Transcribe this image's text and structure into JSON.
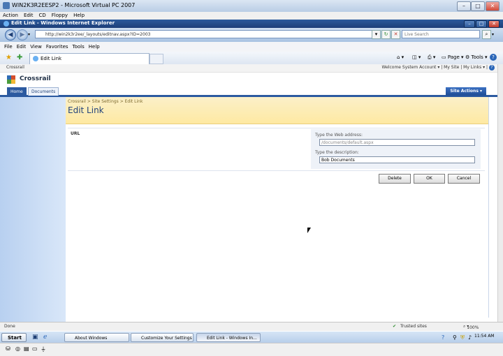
{
  "vpc": {
    "title": "WIN2K3R2EESP2 - Microsoft Virtual PC 2007",
    "menu": [
      "Action",
      "Edit",
      "CD",
      "Floppy",
      "Help"
    ]
  },
  "ie": {
    "title": "Edit Link - Windows Internet Explorer",
    "address": "http://win2k3r2ee/_layouts/editnav.aspx?ID=2003",
    "search_placeholder": "Live Search",
    "menu": [
      "File",
      "Edit",
      "View",
      "Favorites",
      "Tools",
      "Help"
    ],
    "tab_label": "Edit Link",
    "tools": {
      "page": "Page",
      "tools": "Tools"
    }
  },
  "page": {
    "site_name_top": "Crossrail",
    "welcome": "Welcome System Account",
    "my_site": "My Site",
    "my_links": "My Links",
    "site_title": "Crossrail",
    "tabs": [
      "Home",
      "Documents"
    ],
    "site_actions": "Site Actions",
    "breadcrumb": "Crossrail > Site Settings > Edit Link",
    "title": "Edit Link",
    "url_label": "URL",
    "web_address_label": "Type the Web address:",
    "web_address_value": "/documents/default.aspx",
    "description_label": "Type the description:",
    "description_value": "Bob Documents",
    "buttons": {
      "delete": "Delete",
      "ok": "OK",
      "cancel": "Cancel"
    }
  },
  "status": {
    "left": "Done",
    "zone": "Trusted sites",
    "zoom": "100%"
  },
  "taskbar": {
    "start": "Start",
    "items": [
      "About Windows",
      "Customize Your Settings ...",
      "Edit Link - Windows In..."
    ],
    "clock": "11:54 AM"
  }
}
